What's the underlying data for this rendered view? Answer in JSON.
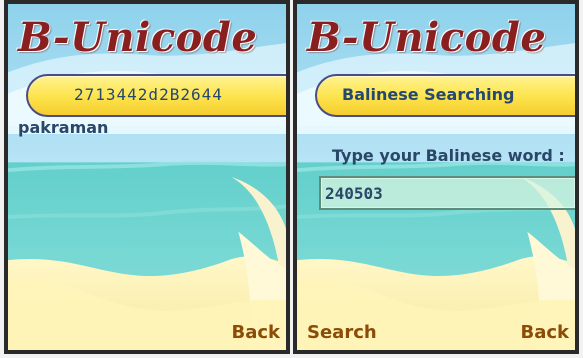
{
  "app": {
    "title": "B-Unicode"
  },
  "left_screen": {
    "header_text": "2713442d2B2644",
    "result_text": "pakraman",
    "softkeys": {
      "right": "Back"
    }
  },
  "right_screen": {
    "header_text": "Balinese Searching",
    "prompt_label": "Type your Balinese word :",
    "input_value": "240503",
    "softkeys": {
      "left": "Search",
      "right": "Back"
    }
  },
  "colors": {
    "title": "#8a1f1f",
    "header_bar": "#fde34b",
    "header_border": "#4b4b86",
    "text_blue": "#2a4668",
    "softkey_brown": "#8a4c07",
    "sky": "#9ed9ef",
    "sea": "#5dc7c7",
    "sand": "#fff5b0",
    "screen_border": "#2a2a2a"
  },
  "icons": [
    "beach-background"
  ]
}
